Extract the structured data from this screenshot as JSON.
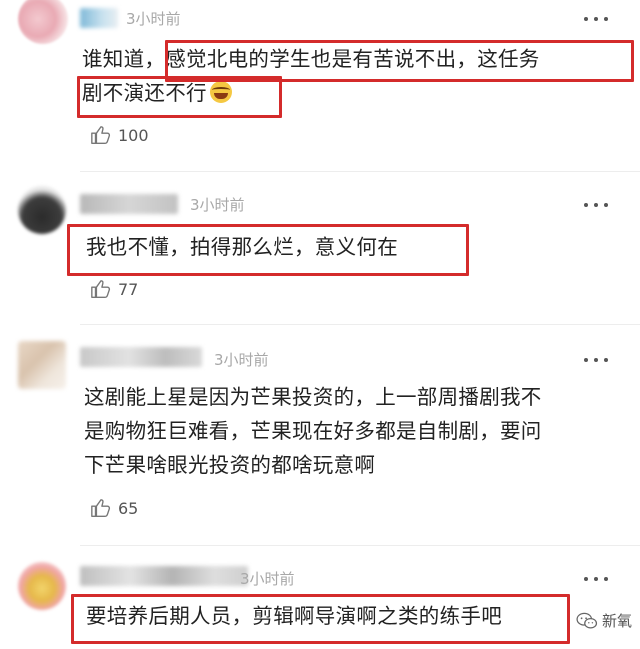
{
  "comments": [
    {
      "time": "3小时前",
      "text_before": "谁知道，",
      "text_highlight": "感觉北电的学生也是有苦说不出，这任务",
      "text_line2": "剧不演还不行",
      "emoji_icon": "laughing-tears-emoji",
      "likes": "100"
    },
    {
      "time": "3小时前",
      "text": "我也不懂，拍得那么烂，意义何在",
      "likes": "77"
    },
    {
      "time": "3小时前",
      "line1": "这剧能上星是因为芒果投资的，上一部周播剧我不",
      "line2": "是购物狂巨难看，芒果现在好多都是自制剧，要问",
      "line3": "下芒果啥眼光投资的都啥玩意啊",
      "likes": "65"
    },
    {
      "time": "3小时前",
      "text": "要培养后期人员，剪辑啊导演啊之类的练手吧"
    }
  ],
  "watermark": {
    "label": "新氧"
  },
  "colors": {
    "highlight_box": "#d42b2b",
    "time_text": "#a8a8a8"
  }
}
